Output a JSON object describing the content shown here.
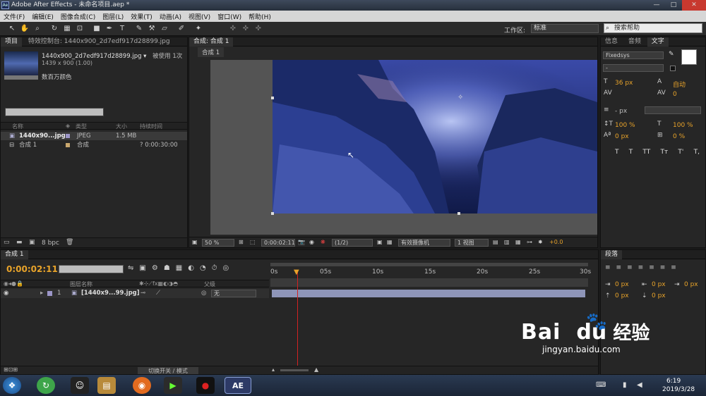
{
  "window": {
    "title": "Adobe After Effects - 未命名项目.aep *",
    "app_badge": "Ae"
  },
  "menu": [
    "文件(F)",
    "编辑(E)",
    "图像合成(C)",
    "图层(L)",
    "效果(T)",
    "动画(A)",
    "视图(V)",
    "窗口(W)",
    "帮助(H)"
  ],
  "toolbar": {
    "workspace_label": "工作区:",
    "workspace_value": "标准",
    "help_placeholder": "搜索帮助"
  },
  "project": {
    "tabs": [
      "项目",
      "特效控制台: 1440x900_2d7edf917d28899.jpg"
    ],
    "file_name": "1440x900_2d7edf917d28899.jpg ▾",
    "used": "被使用 1次",
    "dimensions": "1439 x 900 (1.00)",
    "color": "数百万颜色",
    "columns": [
      "名称",
      "类型",
      "大小",
      "持续时间"
    ],
    "rows": [
      {
        "name": "1440x90...jpg",
        "type": "JPEG",
        "size": "1.5 MB",
        "duration": ""
      },
      {
        "name": "合成 1",
        "type": "合成",
        "size": "",
        "duration": "? 0:00:30:00"
      }
    ],
    "bpc": "8 bpc"
  },
  "composition": {
    "tab": "合成: 合成 1",
    "subtab": "合成 1",
    "zoom": "50 %",
    "timecode": "0:00:02:11",
    "resolution": "(1/2)",
    "camera": "有效摄像机",
    "views": "1 视图",
    "exposure": "+0.0"
  },
  "info_panel": {
    "tabs": [
      "信息",
      "音频",
      "文字"
    ],
    "font": "Fixedsys",
    "font_style": "-",
    "size": "36 px",
    "leading": "自动",
    "kerning": "0",
    "tracking_unit": "- px",
    "vscale": "100 %",
    "hscale": "100 %",
    "baseline": "0 px",
    "tsume": "0 %",
    "styles": [
      "T",
      "T",
      "TT",
      "Tт",
      "T'",
      "T,"
    ]
  },
  "paragraph_panel": {
    "tab": "段落",
    "values": [
      "0 px",
      "0 px",
      "0 px",
      "0 px",
      "0 px"
    ]
  },
  "timeline": {
    "tab": "合成 1",
    "timecode": "0:00:02:11",
    "layer_header": "图层名称",
    "parent_header": "父级",
    "layer": {
      "index": "1",
      "name": "[1440x9...99.jpg]",
      "parent": "无"
    },
    "ruler": [
      "0s",
      "05s",
      "10s",
      "15s",
      "20s",
      "25s",
      "30s"
    ],
    "toggle_label": "切换开关 / 模式"
  },
  "taskbar": {
    "time": "6:19",
    "date": "2019/3/28",
    "ae_label": "AE"
  },
  "watermark": {
    "brand": "Bai",
    "brand2": "du",
    "cn": "经验",
    "url": "jingyan.baidu.com"
  },
  "colors": {
    "accent": "#e8a32a",
    "playhead": "#d22222",
    "layer_bar": "#8e95b8"
  }
}
